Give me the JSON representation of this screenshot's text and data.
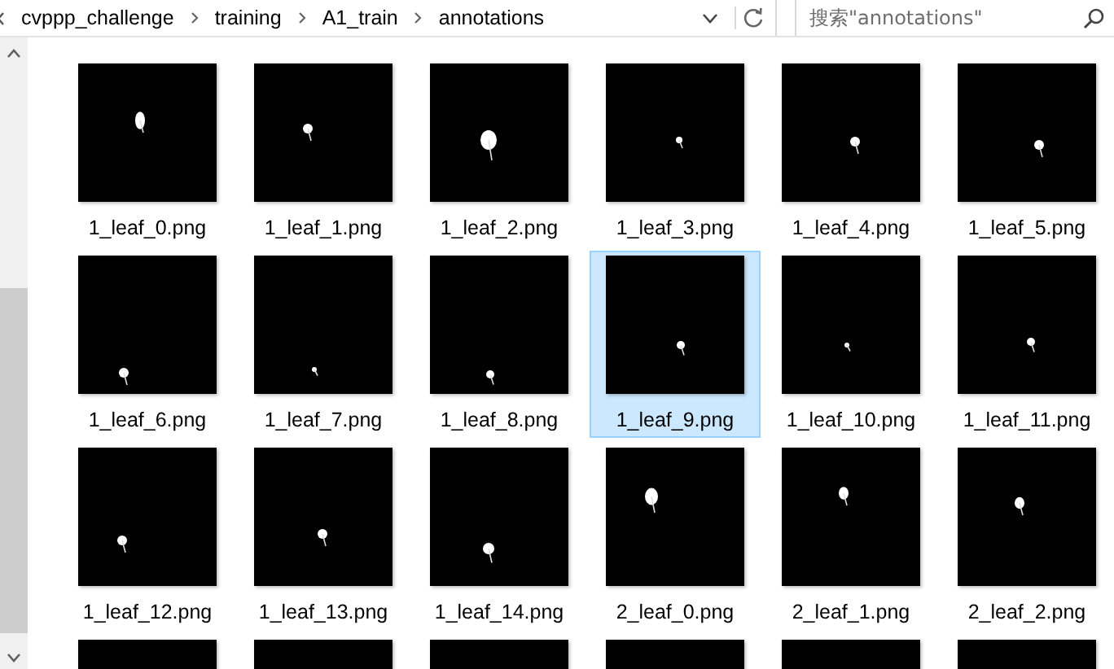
{
  "address_bar": {
    "path": [
      "cvppp_challenge",
      "training",
      "A1_train",
      "annotations"
    ]
  },
  "search": {
    "placeholder": "搜索\"annotations\""
  },
  "files": [
    {
      "label": "1_leaf_0.png",
      "selected": false
    },
    {
      "label": "1_leaf_1.png",
      "selected": false
    },
    {
      "label": "1_leaf_2.png",
      "selected": false
    },
    {
      "label": "1_leaf_3.png",
      "selected": false
    },
    {
      "label": "1_leaf_4.png",
      "selected": false
    },
    {
      "label": "1_leaf_5.png",
      "selected": false
    },
    {
      "label": "1_leaf_6.png",
      "selected": false
    },
    {
      "label": "1_leaf_7.png",
      "selected": false
    },
    {
      "label": "1_leaf_8.png",
      "selected": false
    },
    {
      "label": "1_leaf_9.png",
      "selected": true
    },
    {
      "label": "1_leaf_10.png",
      "selected": false
    },
    {
      "label": "1_leaf_11.png",
      "selected": false
    },
    {
      "label": "1_leaf_12.png",
      "selected": false
    },
    {
      "label": "1_leaf_13.png",
      "selected": false
    },
    {
      "label": "1_leaf_14.png",
      "selected": false
    },
    {
      "label": "2_leaf_0.png",
      "selected": false
    },
    {
      "label": "2_leaf_1.png",
      "selected": false
    },
    {
      "label": "2_leaf_2.png",
      "selected": false
    },
    {
      "selected": false
    },
    {
      "selected": false
    },
    {
      "selected": false
    },
    {
      "selected": false
    },
    {
      "selected": false
    },
    {
      "selected": false
    }
  ]
}
